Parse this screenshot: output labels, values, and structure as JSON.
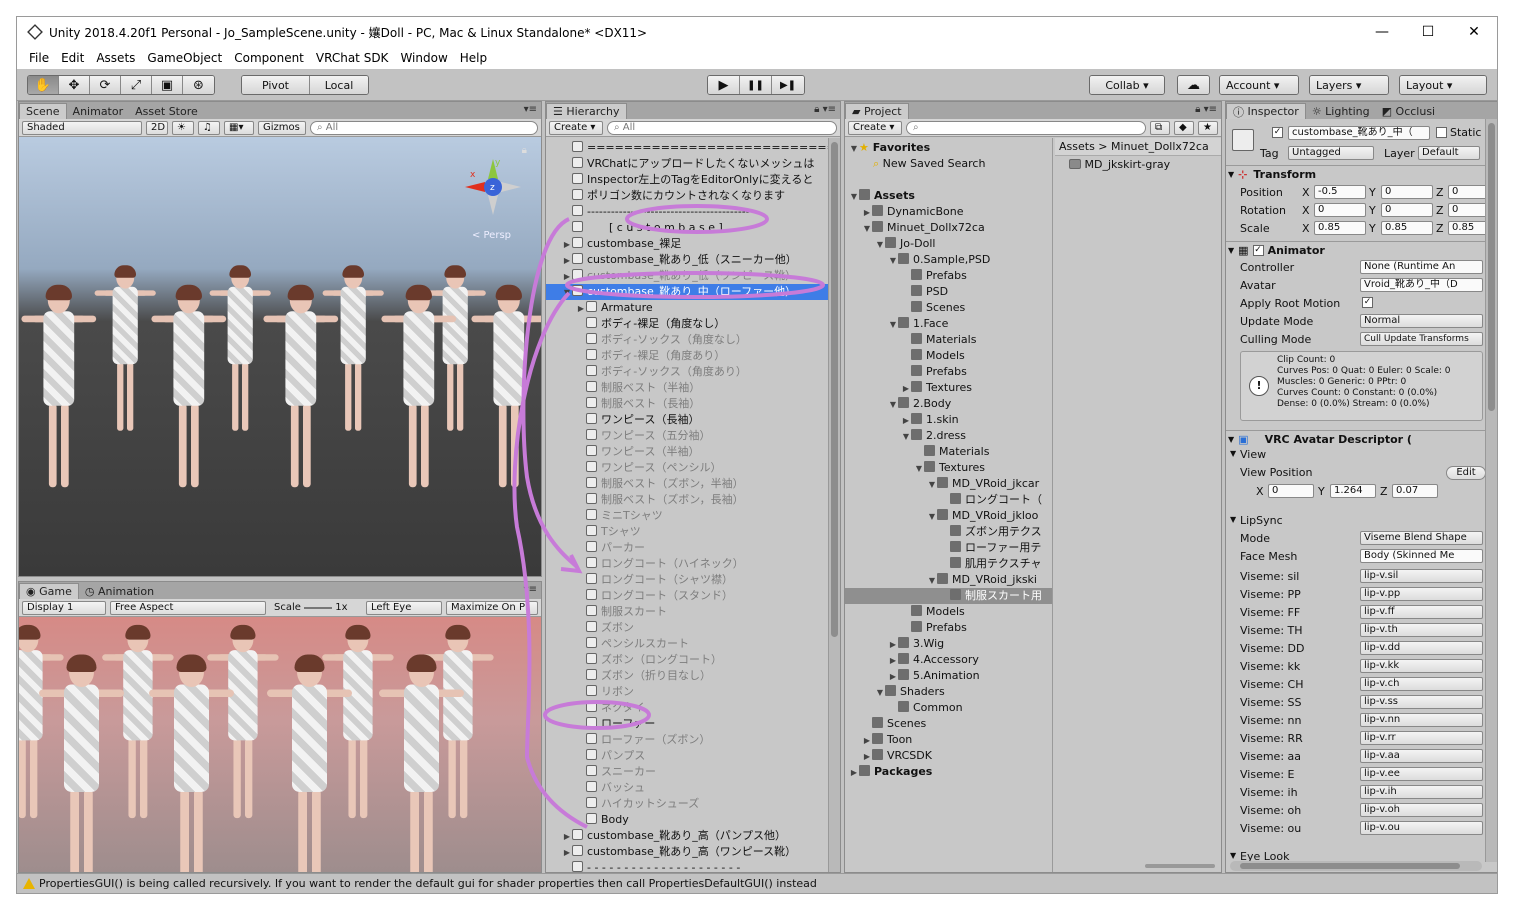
{
  "window": {
    "title": "Unity 2018.4.20f1 Personal - Jo_SampleScene.unity - 孃Doll - PC, Mac & Linux Standalone* <DX11>",
    "minimize": "—",
    "maximize": "☐",
    "close": "✕"
  },
  "menu": [
    "File",
    "Edit",
    "Assets",
    "GameObject",
    "Component",
    "VRChat SDK",
    "Window",
    "Help"
  ],
  "toolbar": {
    "tools": [
      "✋",
      "✥",
      "⟳",
      "⤢",
      "▣",
      "⊛"
    ],
    "pivot": "Pivot",
    "local": "Local",
    "play": "▶",
    "pause": "❚❚",
    "step": "▶❚",
    "collab": "Collab ▾",
    "cloud": "☁",
    "account": "Account",
    "layers": "Layers",
    "layout": "Layout"
  },
  "scene": {
    "tabs": [
      "Scene",
      "Animator",
      "Asset Store"
    ],
    "shading": "Shaded",
    "mode2d": "2D",
    "gizmos": "Gizmos",
    "search_placeholder": "All",
    "persp": "Persp",
    "axis_x": "x",
    "axis_y": "y",
    "axis_z": "z"
  },
  "game": {
    "tabs": [
      "Game",
      "Animation"
    ],
    "display": "Display 1",
    "aspect": "Free Aspect",
    "scale_label": "Scale",
    "scale_value": "1x",
    "eye": "Left Eye",
    "maximize": "Maximize On Pl"
  },
  "hierarchy": {
    "tab": "Hierarchy",
    "create": "Create",
    "search_placeholder": "All",
    "rows": [
      {
        "indent": 0,
        "text": "==========================================",
        "state": "normal",
        "arrow": ""
      },
      {
        "indent": 0,
        "text": "VRChatにアップロードしたくないメッシュは",
        "state": "normal",
        "arrow": ""
      },
      {
        "indent": 0,
        "text": "Inspector左上のTagをEditorOnlyに変えると",
        "state": "normal",
        "arrow": ""
      },
      {
        "indent": 0,
        "text": "ポリゴン数にカウントされなくなります",
        "state": "normal",
        "arrow": ""
      },
      {
        "indent": 0,
        "text": "------------------------------------------",
        "state": "normal",
        "arrow": ""
      },
      {
        "indent": 0,
        "text": "　　[ c u s t o m   b a s e ]",
        "state": "normal",
        "arrow": ""
      },
      {
        "indent": 0,
        "text": "custombase_裸足",
        "state": "normal",
        "arrow": "▶"
      },
      {
        "indent": 0,
        "text": "custombase_靴あり_低（スニーカー他）",
        "state": "normal",
        "arrow": "▶"
      },
      {
        "indent": 0,
        "text": "custombase_靴あり_低（ワンピース靴）",
        "state": "inactive",
        "arrow": "▶"
      },
      {
        "indent": 0,
        "text": "custombase_靴あり_中（ローファー他）",
        "state": "sel",
        "arrow": "▼"
      },
      {
        "indent": 1,
        "text": "Armature",
        "state": "normal",
        "arrow": "▶"
      },
      {
        "indent": 1,
        "text": "ボディ-裸足（角度なし）",
        "state": "normal",
        "arrow": ""
      },
      {
        "indent": 1,
        "text": "ボディ-ソックス（角度なし）",
        "state": "inactive",
        "arrow": ""
      },
      {
        "indent": 1,
        "text": "ボディ-裸足（角度あり）",
        "state": "inactive",
        "arrow": ""
      },
      {
        "indent": 1,
        "text": "ボディ-ソックス（角度あり）",
        "state": "inactive",
        "arrow": ""
      },
      {
        "indent": 1,
        "text": "制服ベスト（半袖）",
        "state": "inactive",
        "arrow": ""
      },
      {
        "indent": 1,
        "text": "制服ベスト（長袖）",
        "state": "inactive",
        "arrow": ""
      },
      {
        "indent": 1,
        "text": "ワンピース（長袖）",
        "state": "normal",
        "arrow": ""
      },
      {
        "indent": 1,
        "text": "ワンピース（五分袖）",
        "state": "inactive",
        "arrow": ""
      },
      {
        "indent": 1,
        "text": "ワンピース（半袖）",
        "state": "inactive",
        "arrow": ""
      },
      {
        "indent": 1,
        "text": "ワンピース（ペンシル）",
        "state": "inactive",
        "arrow": ""
      },
      {
        "indent": 1,
        "text": "制服ベスト（ズボン，半袖）",
        "state": "inactive",
        "arrow": ""
      },
      {
        "indent": 1,
        "text": "制服ベスト（ズボン，長袖）",
        "state": "inactive",
        "arrow": ""
      },
      {
        "indent": 1,
        "text": "ミニTシャツ",
        "state": "inactive",
        "arrow": ""
      },
      {
        "indent": 1,
        "text": "Tシャツ",
        "state": "inactive",
        "arrow": ""
      },
      {
        "indent": 1,
        "text": "パーカー",
        "state": "inactive",
        "arrow": ""
      },
      {
        "indent": 1,
        "text": "ロングコート（ハイネック）",
        "state": "inactive",
        "arrow": ""
      },
      {
        "indent": 1,
        "text": "ロングコート（シャツ襟）",
        "state": "inactive",
        "arrow": ""
      },
      {
        "indent": 1,
        "text": "ロングコート（スタンド）",
        "state": "inactive",
        "arrow": ""
      },
      {
        "indent": 1,
        "text": "制服スカート",
        "state": "inactive",
        "arrow": ""
      },
      {
        "indent": 1,
        "text": "ズボン",
        "state": "inactive",
        "arrow": ""
      },
      {
        "indent": 1,
        "text": "ペンシルスカート",
        "state": "inactive",
        "arrow": ""
      },
      {
        "indent": 1,
        "text": "ズボン（ロングコート）",
        "state": "inactive",
        "arrow": ""
      },
      {
        "indent": 1,
        "text": "ズボン（折り目なし）",
        "state": "inactive",
        "arrow": ""
      },
      {
        "indent": 1,
        "text": "リボン",
        "state": "inactive",
        "arrow": ""
      },
      {
        "indent": 1,
        "text": "ネクタイ",
        "state": "inactive",
        "arrow": ""
      },
      {
        "indent": 1,
        "text": "ローファー",
        "state": "normal",
        "arrow": ""
      },
      {
        "indent": 1,
        "text": "ローファー（ズボン）",
        "state": "inactive",
        "arrow": ""
      },
      {
        "indent": 1,
        "text": "パンプス",
        "state": "inactive",
        "arrow": ""
      },
      {
        "indent": 1,
        "text": "スニーカー",
        "state": "inactive",
        "arrow": ""
      },
      {
        "indent": 1,
        "text": "バッシュ",
        "state": "inactive",
        "arrow": ""
      },
      {
        "indent": 1,
        "text": "ハイカットシューズ",
        "state": "inactive",
        "arrow": ""
      },
      {
        "indent": 1,
        "text": "Body",
        "state": "normal",
        "arrow": ""
      },
      {
        "indent": 0,
        "text": "custombase_靴あり_高（パンプス他）",
        "state": "normal",
        "arrow": "▶"
      },
      {
        "indent": 0,
        "text": "custombase_靴あり_高（ワンピース靴）",
        "state": "normal",
        "arrow": "▶"
      },
      {
        "indent": 0,
        "text": "- - - - - - - - - - - - - - - - - - - - -",
        "state": "normal",
        "arrow": ""
      }
    ]
  },
  "project": {
    "tab": "Project",
    "create": "Create",
    "favorites": "Favorites",
    "new_saved_search": "New Saved Search",
    "breadcrumb": [
      "Assets",
      "Minuet_Dollx72ca"
    ],
    "selected_asset": "MD_jkskirt-gray",
    "tree": [
      {
        "indent": 0,
        "text": "Assets",
        "arrow": "▼",
        "bold": true
      },
      {
        "indent": 1,
        "text": "DynamicBone",
        "arrow": "▶"
      },
      {
        "indent": 1,
        "text": "Minuet_Dollx72ca",
        "arrow": "▼"
      },
      {
        "indent": 2,
        "text": "Jo-Doll",
        "arrow": "▼"
      },
      {
        "indent": 3,
        "text": "0.Sample,PSD",
        "arrow": "▼"
      },
      {
        "indent": 4,
        "text": "Prefabs",
        "arrow": ""
      },
      {
        "indent": 4,
        "text": "PSD",
        "arrow": ""
      },
      {
        "indent": 4,
        "text": "Scenes",
        "arrow": ""
      },
      {
        "indent": 3,
        "text": "1.Face",
        "arrow": "▼"
      },
      {
        "indent": 4,
        "text": "Materials",
        "arrow": ""
      },
      {
        "indent": 4,
        "text": "Models",
        "arrow": ""
      },
      {
        "indent": 4,
        "text": "Prefabs",
        "arrow": ""
      },
      {
        "indent": 4,
        "text": "Textures",
        "arrow": "▶"
      },
      {
        "indent": 3,
        "text": "2.Body",
        "arrow": "▼"
      },
      {
        "indent": 4,
        "text": "1.skin",
        "arrow": "▶"
      },
      {
        "indent": 4,
        "text": "2.dress",
        "arrow": "▼"
      },
      {
        "indent": 5,
        "text": "Materials",
        "arrow": ""
      },
      {
        "indent": 5,
        "text": "Textures",
        "arrow": "▼"
      },
      {
        "indent": 6,
        "text": "MD_VRoid_jkcar",
        "arrow": "▼"
      },
      {
        "indent": 7,
        "text": "ロングコート（",
        "arrow": ""
      },
      {
        "indent": 6,
        "text": "MD_VRoid_jkloo",
        "arrow": "▼"
      },
      {
        "indent": 7,
        "text": "ズボン用テクス",
        "arrow": ""
      },
      {
        "indent": 7,
        "text": "ローファー用テ",
        "arrow": ""
      },
      {
        "indent": 7,
        "text": "肌用テクスチャ",
        "arrow": ""
      },
      {
        "indent": 6,
        "text": "MD_VRoid_jkski",
        "arrow": "▼"
      },
      {
        "indent": 7,
        "text": "制服スカート用",
        "arrow": "",
        "sel": true
      },
      {
        "indent": 4,
        "text": "Models",
        "arrow": ""
      },
      {
        "indent": 4,
        "text": "Prefabs",
        "arrow": ""
      },
      {
        "indent": 3,
        "text": "3.Wig",
        "arrow": "▶"
      },
      {
        "indent": 3,
        "text": "4.Accessory",
        "arrow": "▶"
      },
      {
        "indent": 3,
        "text": "5.Animation",
        "arrow": "▶"
      },
      {
        "indent": 2,
        "text": "Shaders",
        "arrow": "▼"
      },
      {
        "indent": 3,
        "text": "Common",
        "arrow": ""
      },
      {
        "indent": 1,
        "text": "Scenes",
        "arrow": ""
      },
      {
        "indent": 1,
        "text": "Toon",
        "arrow": "▶"
      },
      {
        "indent": 1,
        "text": "VRCSDK",
        "arrow": "▶"
      },
      {
        "indent": 0,
        "text": "Packages",
        "arrow": "▶",
        "bold": true
      }
    ]
  },
  "inspector": {
    "tabs": [
      "Inspector",
      "Lighting",
      "Occlusi"
    ],
    "object_name": "custombase_靴あり_中（",
    "static_label": "Static",
    "tag_label": "Tag",
    "tag_value": "Untagged",
    "layer_label": "Layer",
    "layer_value": "Default",
    "transform": {
      "title": "Transform",
      "position_label": "Position",
      "rotation_label": "Rotation",
      "scale_label": "Scale",
      "position": [
        "-0.5",
        "0",
        "0"
      ],
      "rotation": [
        "0",
        "0",
        "0"
      ],
      "scale": [
        "0.85",
        "0.85",
        "0.85"
      ]
    },
    "animator": {
      "title": "Animator",
      "controller_label": "Controller",
      "controller_value": "None (Runtime An",
      "avatar_label": "Avatar",
      "avatar_value": "Vroid_靴あり_中（D",
      "apply_root_label": "Apply Root Motion",
      "update_mode_label": "Update Mode",
      "update_mode_value": "Normal",
      "culling_mode_label": "Culling Mode",
      "culling_mode_value": "Cull Update Transforms",
      "info_lines": [
        "Clip Count: 0",
        "Curves Pos: 0 Quat: 0 Euler: 0 Scale: 0",
        "Muscles: 0 Generic: 0 PPtr: 0",
        "Curves Count: 0 Constant: 0 (0.0%)",
        "Dense: 0 (0.0%) Stream: 0 (0.0%)"
      ]
    },
    "vrc": {
      "title": "VRC Avatar Descriptor (",
      "view_label": "View",
      "view_position_label": "View Position",
      "edit_label": "Edit",
      "view_position": [
        "0",
        "1.264",
        "0.07"
      ],
      "lipsync_label": "LipSync",
      "mode_label": "Mode",
      "mode_value": "Viseme Blend Shape",
      "face_mesh_label": "Face Mesh",
      "face_mesh_value": "Body (Skinned Me",
      "visemes": [
        {
          "label": "Viseme: sil",
          "value": "lip-v.sil"
        },
        {
          "label": "Viseme: PP",
          "value": "lip-v.pp"
        },
        {
          "label": "Viseme: FF",
          "value": "lip-v.ff"
        },
        {
          "label": "Viseme: TH",
          "value": "lip-v.th"
        },
        {
          "label": "Viseme: DD",
          "value": "lip-v.dd"
        },
        {
          "label": "Viseme: kk",
          "value": "lip-v.kk"
        },
        {
          "label": "Viseme: CH",
          "value": "lip-v.ch"
        },
        {
          "label": "Viseme: SS",
          "value": "lip-v.ss"
        },
        {
          "label": "Viseme: nn",
          "value": "lip-v.nn"
        },
        {
          "label": "Viseme: RR",
          "value": "lip-v.rr"
        },
        {
          "label": "Viseme: aa",
          "value": "lip-v.aa"
        },
        {
          "label": "Viseme: E",
          "value": "lip-v.ee"
        },
        {
          "label": "Viseme: ih",
          "value": "lip-v.ih"
        },
        {
          "label": "Viseme: oh",
          "value": "lip-v.oh"
        },
        {
          "label": "Viseme: ou",
          "value": "lip-v.ou"
        }
      ],
      "eye_look_label": "Eye Look"
    },
    "axis": [
      "X",
      "Y",
      "Z"
    ]
  },
  "status": {
    "message": "PropertiesGUI() is being called recursively. If you want to render the default gui for shader properties then call PropertiesDefaultGUI() instead"
  },
  "colors": {
    "selection": "#3e7de7",
    "annotation": "#c77bd8",
    "warning": "#e8b400"
  }
}
